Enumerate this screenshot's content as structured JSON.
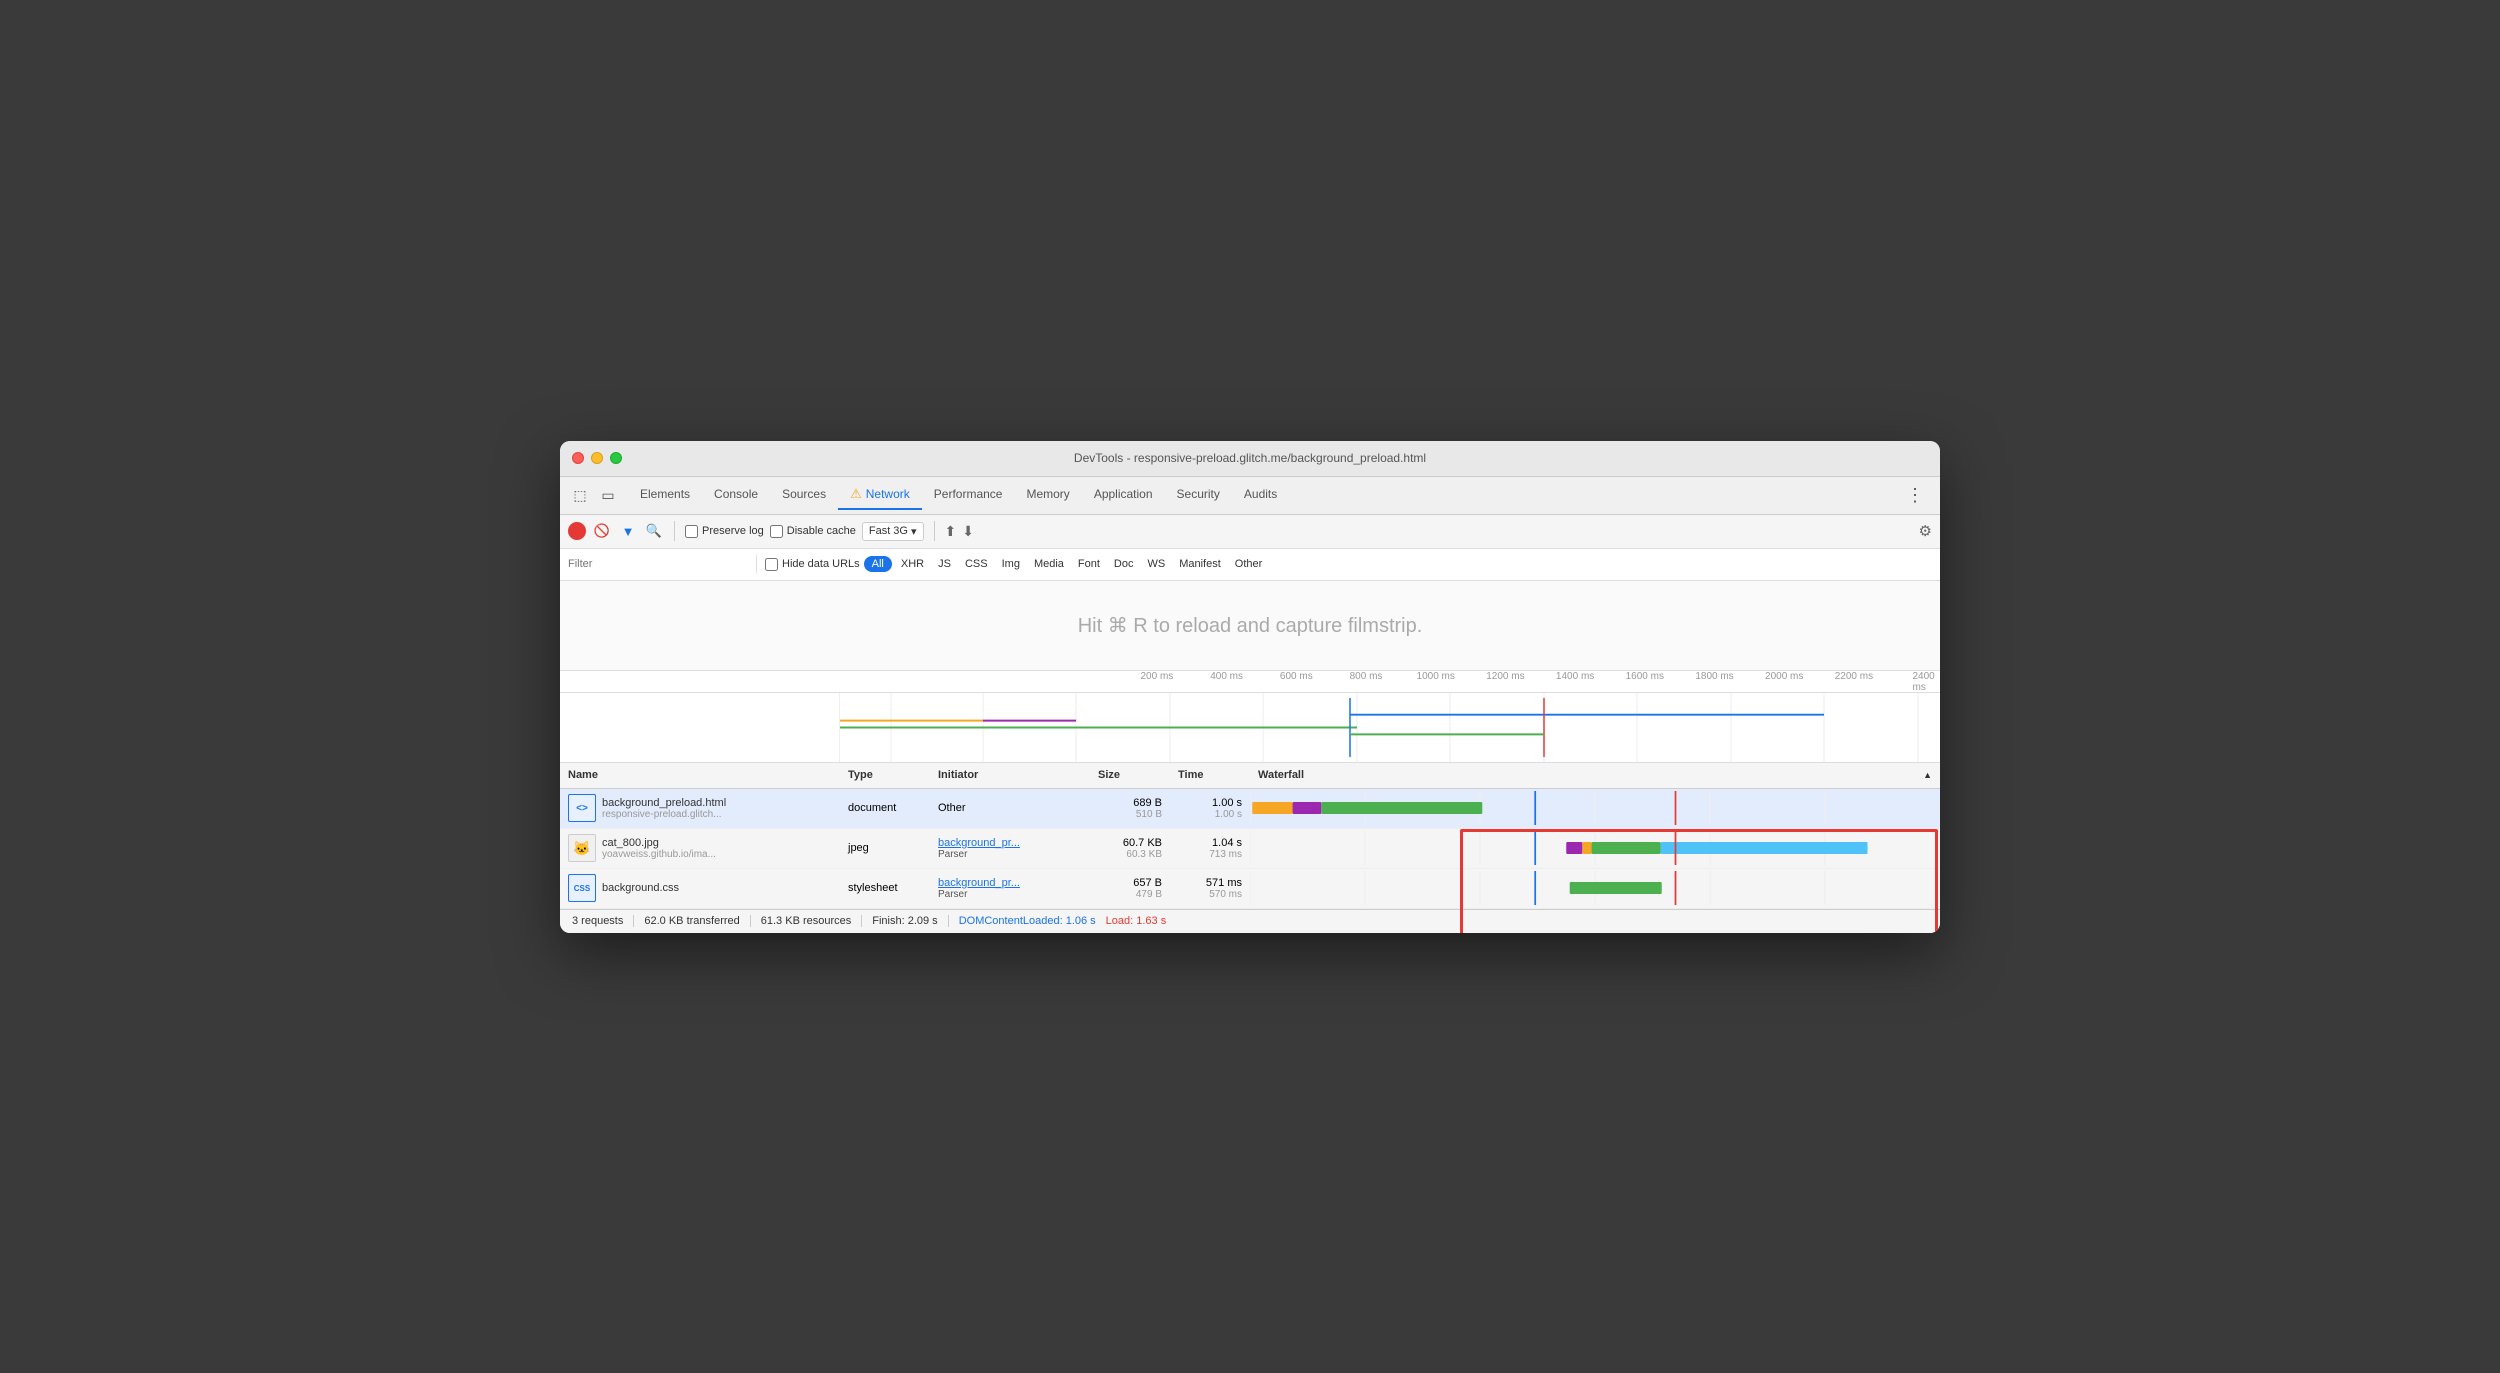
{
  "window": {
    "title": "DevTools - responsive-preload.glitch.me/background_preload.html"
  },
  "tabs": [
    {
      "label": "Elements",
      "active": false
    },
    {
      "label": "Console",
      "active": false
    },
    {
      "label": "Sources",
      "active": false
    },
    {
      "label": "Network",
      "active": true,
      "warning": true
    },
    {
      "label": "Performance",
      "active": false
    },
    {
      "label": "Memory",
      "active": false
    },
    {
      "label": "Application",
      "active": false
    },
    {
      "label": "Security",
      "active": false
    },
    {
      "label": "Audits",
      "active": false
    }
  ],
  "toolbar": {
    "preserve_log": "Preserve log",
    "disable_cache": "Disable cache",
    "throttle": "Fast 3G"
  },
  "filter": {
    "placeholder": "Filter",
    "hide_data_urls": "Hide data URLs",
    "buttons": [
      "All",
      "XHR",
      "JS",
      "CSS",
      "Img",
      "Media",
      "Font",
      "Doc",
      "WS",
      "Manifest",
      "Other"
    ]
  },
  "filmstrip": {
    "message": "Hit ⌘ R to reload and capture filmstrip."
  },
  "timeline": {
    "marks": [
      "200 ms",
      "400 ms",
      "600 ms",
      "800 ms",
      "1000 ms",
      "1200 ms",
      "1400 ms",
      "1600 ms",
      "1800 ms",
      "2000 ms",
      "2200 ms",
      "2400 ms"
    ]
  },
  "table": {
    "columns": [
      "Name",
      "Type",
      "Initiator",
      "Size",
      "Time",
      "Waterfall"
    ],
    "rows": [
      {
        "filename": "background_preload.html",
        "fileurl": "responsive-preload.glitch...",
        "type": "document",
        "initiator_label": "Other",
        "initiator_link": false,
        "size_main": "689 B",
        "size_sub": "510 B",
        "time_main": "1.00 s",
        "time_sub": "1.00 s",
        "icon_type": "html",
        "icon_label": "<>",
        "selected": true
      },
      {
        "filename": "cat_800.jpg",
        "fileurl": "yoavweiss.github.io/ima...",
        "type": "jpeg",
        "initiator_label": "background_pr...",
        "initiator_sub": "Parser",
        "initiator_link": true,
        "size_main": "60.7 KB",
        "size_sub": "60.3 KB",
        "time_main": "1.04 s",
        "time_sub": "713 ms",
        "icon_type": "img",
        "icon_label": "🖼",
        "selected": false
      },
      {
        "filename": "background.css",
        "fileurl": "",
        "type": "stylesheet",
        "initiator_label": "background_pr...",
        "initiator_sub": "Parser",
        "initiator_link": true,
        "size_main": "657 B",
        "size_sub": "479 B",
        "time_main": "571 ms",
        "time_sub": "570 ms",
        "icon_type": "css-icon",
        "icon_label": "CSS",
        "selected": false
      }
    ]
  },
  "statusbar": {
    "requests": "3 requests",
    "transferred": "62.0 KB transferred",
    "resources": "61.3 KB resources",
    "finish": "Finish: 2.09 s",
    "domcontent": "DOMContentLoaded: 1.06 s",
    "load": "Load: 1.63 s"
  }
}
